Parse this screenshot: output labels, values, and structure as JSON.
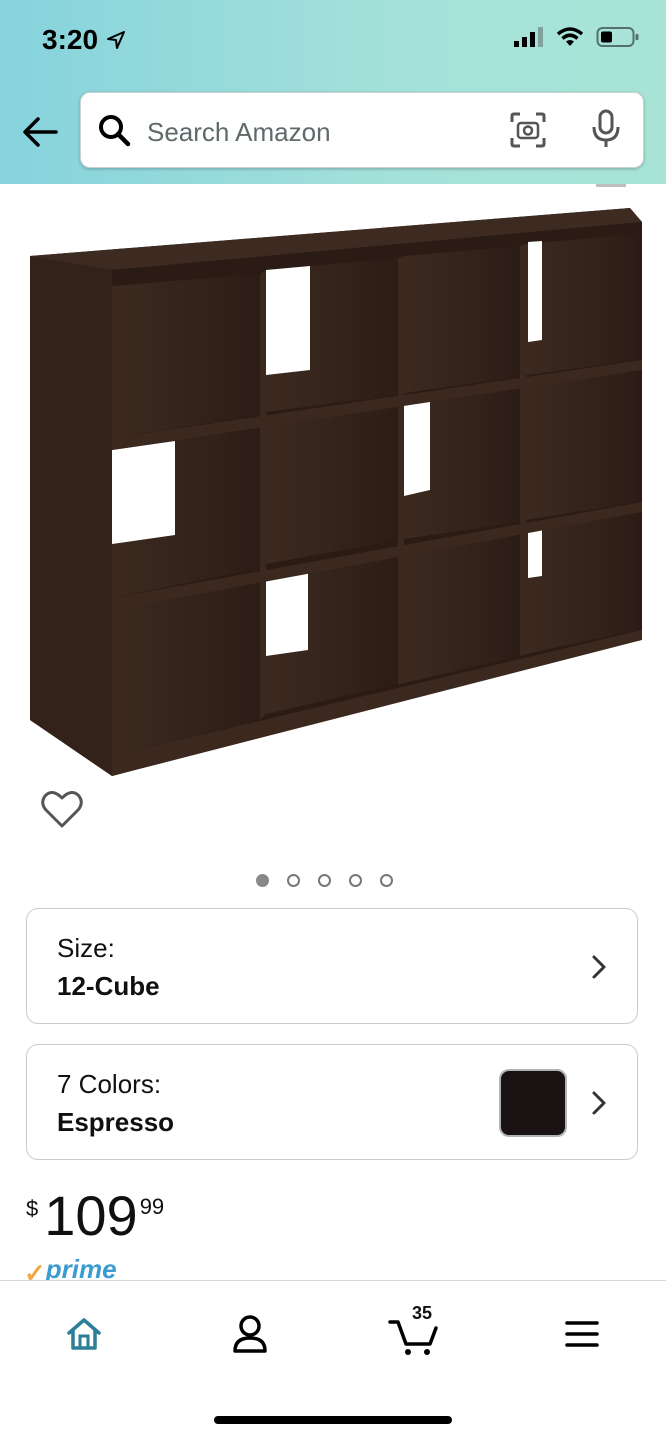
{
  "status_bar": {
    "time": "3:20"
  },
  "search": {
    "placeholder": "Search Amazon"
  },
  "product": {
    "image_count": 5,
    "active_image_index": 0
  },
  "size_option": {
    "label": "Size:",
    "value": "12-Cube"
  },
  "color_option": {
    "label": "7 Colors:",
    "value": "Espresso",
    "swatch_color": "#1a1212"
  },
  "price": {
    "symbol": "$",
    "whole": "109",
    "fraction": "99"
  },
  "prime": {
    "check": "✓",
    "text": "prime"
  },
  "bottom_nav": {
    "items": [
      "home-icon",
      "account-icon",
      "cart-icon",
      "menu-icon"
    ],
    "cart_count": "35"
  },
  "colors": {
    "header_start": "#86d3dd",
    "header_end": "#a8e4d6",
    "prime_blue": "#3c9bd1",
    "prime_orange": "#f3a847",
    "home_active": "#2a7f96"
  }
}
